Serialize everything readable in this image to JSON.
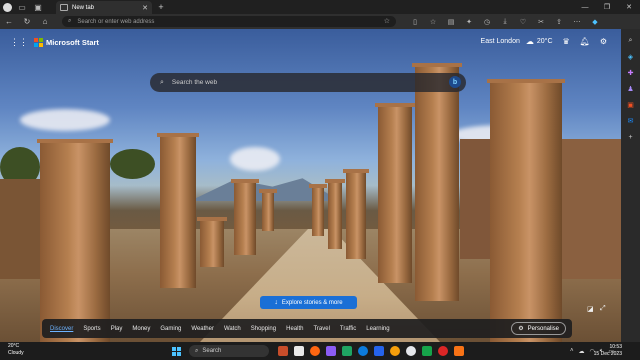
{
  "browser": {
    "tab_title": "New tab",
    "address_placeholder": "Search or enter web address"
  },
  "msn": {
    "brand": "Microsoft Start",
    "location": "East London",
    "temperature": "20°C",
    "search_placeholder": "Search the web",
    "bing_label": "b",
    "explore_label": "Explore stories & more",
    "nav": [
      {
        "label": "Discover"
      },
      {
        "label": "Sports"
      },
      {
        "label": "Play"
      },
      {
        "label": "Money"
      },
      {
        "label": "Gaming"
      },
      {
        "label": "Weather"
      },
      {
        "label": "Watch"
      },
      {
        "label": "Shopping"
      },
      {
        "label": "Health"
      },
      {
        "label": "Travel"
      },
      {
        "label": "Traffic"
      },
      {
        "label": "Learning"
      }
    ],
    "personalise_label": "Personalise"
  },
  "taskbar": {
    "weather_temp": "20°C",
    "weather_desc": "Cloudy",
    "search_label": "Search",
    "time": "10:53",
    "date": "15 Dec 2023"
  },
  "colors": {
    "accent": "#1a6fd6",
    "ms_red": "#f25022",
    "ms_green": "#7fba00",
    "ms_blue": "#00a4ef",
    "ms_yellow": "#ffb900"
  }
}
